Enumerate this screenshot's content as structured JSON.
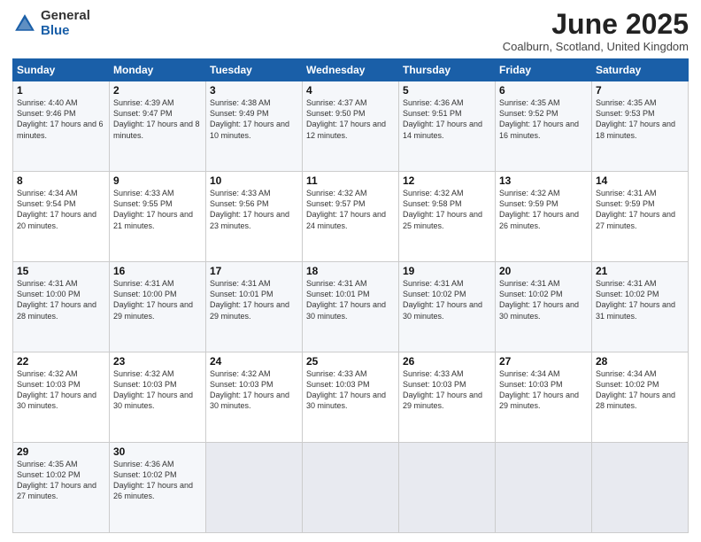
{
  "logo": {
    "general": "General",
    "blue": "Blue"
  },
  "header": {
    "month": "June 2025",
    "location": "Coalburn, Scotland, United Kingdom"
  },
  "weekdays": [
    "Sunday",
    "Monday",
    "Tuesday",
    "Wednesday",
    "Thursday",
    "Friday",
    "Saturday"
  ],
  "weeks": [
    [
      {
        "day": "1",
        "sunrise": "Sunrise: 4:40 AM",
        "sunset": "Sunset: 9:46 PM",
        "daylight": "Daylight: 17 hours and 6 minutes."
      },
      {
        "day": "2",
        "sunrise": "Sunrise: 4:39 AM",
        "sunset": "Sunset: 9:47 PM",
        "daylight": "Daylight: 17 hours and 8 minutes."
      },
      {
        "day": "3",
        "sunrise": "Sunrise: 4:38 AM",
        "sunset": "Sunset: 9:49 PM",
        "daylight": "Daylight: 17 hours and 10 minutes."
      },
      {
        "day": "4",
        "sunrise": "Sunrise: 4:37 AM",
        "sunset": "Sunset: 9:50 PM",
        "daylight": "Daylight: 17 hours and 12 minutes."
      },
      {
        "day": "5",
        "sunrise": "Sunrise: 4:36 AM",
        "sunset": "Sunset: 9:51 PM",
        "daylight": "Daylight: 17 hours and 14 minutes."
      },
      {
        "day": "6",
        "sunrise": "Sunrise: 4:35 AM",
        "sunset": "Sunset: 9:52 PM",
        "daylight": "Daylight: 17 hours and 16 minutes."
      },
      {
        "day": "7",
        "sunrise": "Sunrise: 4:35 AM",
        "sunset": "Sunset: 9:53 PM",
        "daylight": "Daylight: 17 hours and 18 minutes."
      }
    ],
    [
      {
        "day": "8",
        "sunrise": "Sunrise: 4:34 AM",
        "sunset": "Sunset: 9:54 PM",
        "daylight": "Daylight: 17 hours and 20 minutes."
      },
      {
        "day": "9",
        "sunrise": "Sunrise: 4:33 AM",
        "sunset": "Sunset: 9:55 PM",
        "daylight": "Daylight: 17 hours and 21 minutes."
      },
      {
        "day": "10",
        "sunrise": "Sunrise: 4:33 AM",
        "sunset": "Sunset: 9:56 PM",
        "daylight": "Daylight: 17 hours and 23 minutes."
      },
      {
        "day": "11",
        "sunrise": "Sunrise: 4:32 AM",
        "sunset": "Sunset: 9:57 PM",
        "daylight": "Daylight: 17 hours and 24 minutes."
      },
      {
        "day": "12",
        "sunrise": "Sunrise: 4:32 AM",
        "sunset": "Sunset: 9:58 PM",
        "daylight": "Daylight: 17 hours and 25 minutes."
      },
      {
        "day": "13",
        "sunrise": "Sunrise: 4:32 AM",
        "sunset": "Sunset: 9:59 PM",
        "daylight": "Daylight: 17 hours and 26 minutes."
      },
      {
        "day": "14",
        "sunrise": "Sunrise: 4:31 AM",
        "sunset": "Sunset: 9:59 PM",
        "daylight": "Daylight: 17 hours and 27 minutes."
      }
    ],
    [
      {
        "day": "15",
        "sunrise": "Sunrise: 4:31 AM",
        "sunset": "Sunset: 10:00 PM",
        "daylight": "Daylight: 17 hours and 28 minutes."
      },
      {
        "day": "16",
        "sunrise": "Sunrise: 4:31 AM",
        "sunset": "Sunset: 10:00 PM",
        "daylight": "Daylight: 17 hours and 29 minutes."
      },
      {
        "day": "17",
        "sunrise": "Sunrise: 4:31 AM",
        "sunset": "Sunset: 10:01 PM",
        "daylight": "Daylight: 17 hours and 29 minutes."
      },
      {
        "day": "18",
        "sunrise": "Sunrise: 4:31 AM",
        "sunset": "Sunset: 10:01 PM",
        "daylight": "Daylight: 17 hours and 30 minutes."
      },
      {
        "day": "19",
        "sunrise": "Sunrise: 4:31 AM",
        "sunset": "Sunset: 10:02 PM",
        "daylight": "Daylight: 17 hours and 30 minutes."
      },
      {
        "day": "20",
        "sunrise": "Sunrise: 4:31 AM",
        "sunset": "Sunset: 10:02 PM",
        "daylight": "Daylight: 17 hours and 30 minutes."
      },
      {
        "day": "21",
        "sunrise": "Sunrise: 4:31 AM",
        "sunset": "Sunset: 10:02 PM",
        "daylight": "Daylight: 17 hours and 31 minutes."
      }
    ],
    [
      {
        "day": "22",
        "sunrise": "Sunrise: 4:32 AM",
        "sunset": "Sunset: 10:03 PM",
        "daylight": "Daylight: 17 hours and 30 minutes."
      },
      {
        "day": "23",
        "sunrise": "Sunrise: 4:32 AM",
        "sunset": "Sunset: 10:03 PM",
        "daylight": "Daylight: 17 hours and 30 minutes."
      },
      {
        "day": "24",
        "sunrise": "Sunrise: 4:32 AM",
        "sunset": "Sunset: 10:03 PM",
        "daylight": "Daylight: 17 hours and 30 minutes."
      },
      {
        "day": "25",
        "sunrise": "Sunrise: 4:33 AM",
        "sunset": "Sunset: 10:03 PM",
        "daylight": "Daylight: 17 hours and 30 minutes."
      },
      {
        "day": "26",
        "sunrise": "Sunrise: 4:33 AM",
        "sunset": "Sunset: 10:03 PM",
        "daylight": "Daylight: 17 hours and 29 minutes."
      },
      {
        "day": "27",
        "sunrise": "Sunrise: 4:34 AM",
        "sunset": "Sunset: 10:03 PM",
        "daylight": "Daylight: 17 hours and 29 minutes."
      },
      {
        "day": "28",
        "sunrise": "Sunrise: 4:34 AM",
        "sunset": "Sunset: 10:02 PM",
        "daylight": "Daylight: 17 hours and 28 minutes."
      }
    ],
    [
      {
        "day": "29",
        "sunrise": "Sunrise: 4:35 AM",
        "sunset": "Sunset: 10:02 PM",
        "daylight": "Daylight: 17 hours and 27 minutes."
      },
      {
        "day": "30",
        "sunrise": "Sunrise: 4:36 AM",
        "sunset": "Sunset: 10:02 PM",
        "daylight": "Daylight: 17 hours and 26 minutes."
      },
      null,
      null,
      null,
      null,
      null
    ]
  ]
}
